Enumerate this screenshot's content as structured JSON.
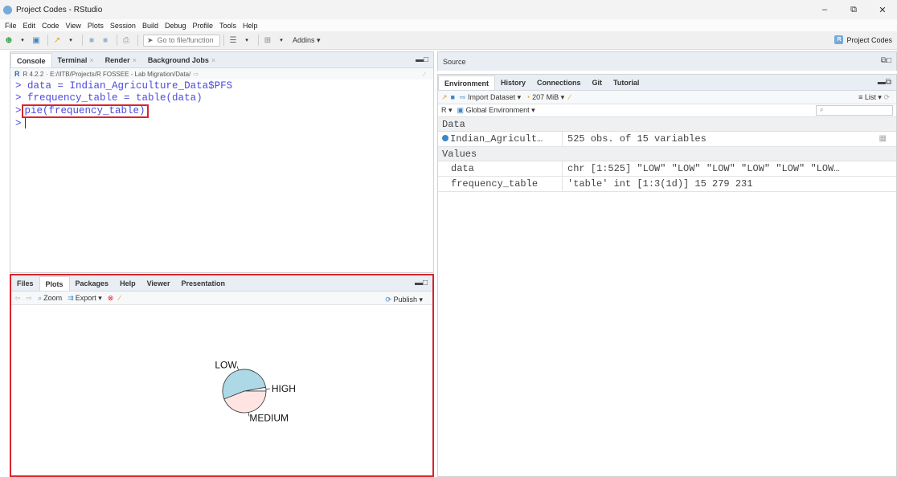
{
  "window": {
    "title": "Project Codes - RStudio",
    "minimize": "–",
    "restore": "⧉",
    "close": "✕"
  },
  "menu": [
    "File",
    "Edit",
    "Code",
    "View",
    "Plots",
    "Session",
    "Build",
    "Debug",
    "Profile",
    "Tools",
    "Help"
  ],
  "toolbar": {
    "goto_placeholder": "Go to file/function",
    "addins": "Addins",
    "project": "Project Codes"
  },
  "console": {
    "tabs": [
      "Console",
      "Terminal",
      "Render",
      "Background Jobs"
    ],
    "r_version": "R 4.2.2",
    "path": "· E:/IITB/Projects/R FOSSEE - Lab Migration/Data/",
    "lines": [
      "data = Indian_Agriculture_Data$PFS",
      "frequency_table = table(data)",
      "pie(frequency_table)"
    ],
    "prompt": ">"
  },
  "plots": {
    "tabs": [
      "Files",
      "Plots",
      "Packages",
      "Help",
      "Viewer",
      "Presentation"
    ],
    "zoom": "Zoom",
    "export": "Export",
    "publish": "Publish"
  },
  "chart_data": {
    "type": "pie",
    "categories": [
      "HIGH",
      "LOW",
      "MEDIUM"
    ],
    "values": [
      15,
      279,
      231
    ],
    "colors": [
      "#ffffff",
      "#add8e6",
      "#ffe4e1"
    ],
    "title": ""
  },
  "source": {
    "label": "Source"
  },
  "environment": {
    "tabs": [
      "Environment",
      "History",
      "Connections",
      "Git",
      "Tutorial"
    ],
    "import_dataset": "Import Dataset",
    "memory": "207 MiB",
    "list": "List",
    "language": "R",
    "scope": "Global Environment",
    "sections": {
      "data": "Data",
      "values": "Values"
    },
    "data_rows": [
      {
        "name": "Indian_Agricult…",
        "value": "525 obs. of 15 variables"
      }
    ],
    "value_rows": [
      {
        "name": "data",
        "value": "chr [1:525] \"LOW\" \"LOW\" \"LOW\" \"LOW\" \"LOW\" \"LOW…"
      },
      {
        "name": "frequency_table",
        "value": "'table' int [1:3(1d)] 15 279 231"
      }
    ]
  }
}
